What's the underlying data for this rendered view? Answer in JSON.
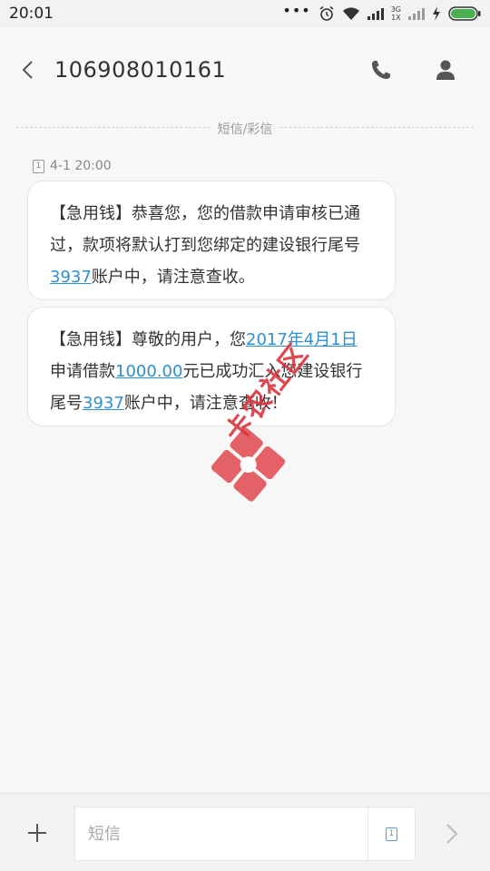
{
  "status_bar": {
    "time": "20:01",
    "dots": "•••",
    "network_label_top": "3G",
    "network_label_bottom": "1X"
  },
  "header": {
    "contact_number": "106908010161"
  },
  "divider": {
    "label": "短信/彩信"
  },
  "thread": {
    "sim_number": "1",
    "timestamp": "4-1 20:00",
    "messages": [
      {
        "part1": "【急用钱】恭喜您，您的借款申请审核已通过，款项将默认打到您绑定的建设银行尾号",
        "link1": "3937",
        "part2": "账户中，请注意查收。"
      },
      {
        "part1": "【急用钱】尊敬的用户，您",
        "link1": "2017年4月1日",
        "part2": "申请借款",
        "link2": "1000.00",
        "part3": "元已成功汇入您建设银行尾号",
        "link3": "3937",
        "part4": "账户中，请注意查收！"
      }
    ]
  },
  "watermark": {
    "text": "卡农社区"
  },
  "composer": {
    "placeholder": "短信",
    "value": "",
    "sim_number": "1"
  },
  "colors": {
    "link": "#2f8fd1",
    "background": "#f7f7f7",
    "bubble": "#ffffff",
    "battery": "#4caf50",
    "watermark": "#d9363e"
  }
}
